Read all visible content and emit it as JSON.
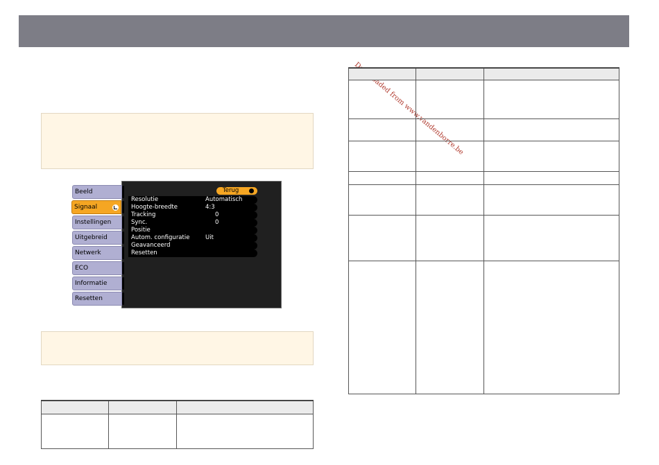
{
  "watermark": "Downloaded from www.vandenborre.be",
  "menu": {
    "tabs": [
      {
        "label": "Beeld"
      },
      {
        "label": "Signaal"
      },
      {
        "label": "Instellingen"
      },
      {
        "label": "Uitgebreid"
      },
      {
        "label": "Netwerk"
      },
      {
        "label": "ECO"
      },
      {
        "label": "Informatie"
      },
      {
        "label": "Resetten"
      }
    ],
    "active_tab": "Signaal",
    "back_label": "Terug",
    "items": [
      {
        "label": "Resolutie",
        "value": "Automatisch"
      },
      {
        "label": "Hoogte-breedte",
        "value": "4:3"
      },
      {
        "label": "Tracking",
        "value": "0"
      },
      {
        "label": "Sync.",
        "value": "0"
      },
      {
        "label": "Positie",
        "value": ""
      },
      {
        "label": "Autom. configuratie",
        "value": "Uit"
      },
      {
        "label": "Geavanceerd",
        "value": ""
      },
      {
        "label": "Resetten",
        "value": ""
      }
    ]
  },
  "colors": {
    "header_bar": "#7d7d86",
    "note_background": "#fff6e5",
    "tab_inactive": "#b0afd2",
    "tab_active": "#f5a623",
    "menu_background": "#202020",
    "watermark": "#b03a2e"
  }
}
